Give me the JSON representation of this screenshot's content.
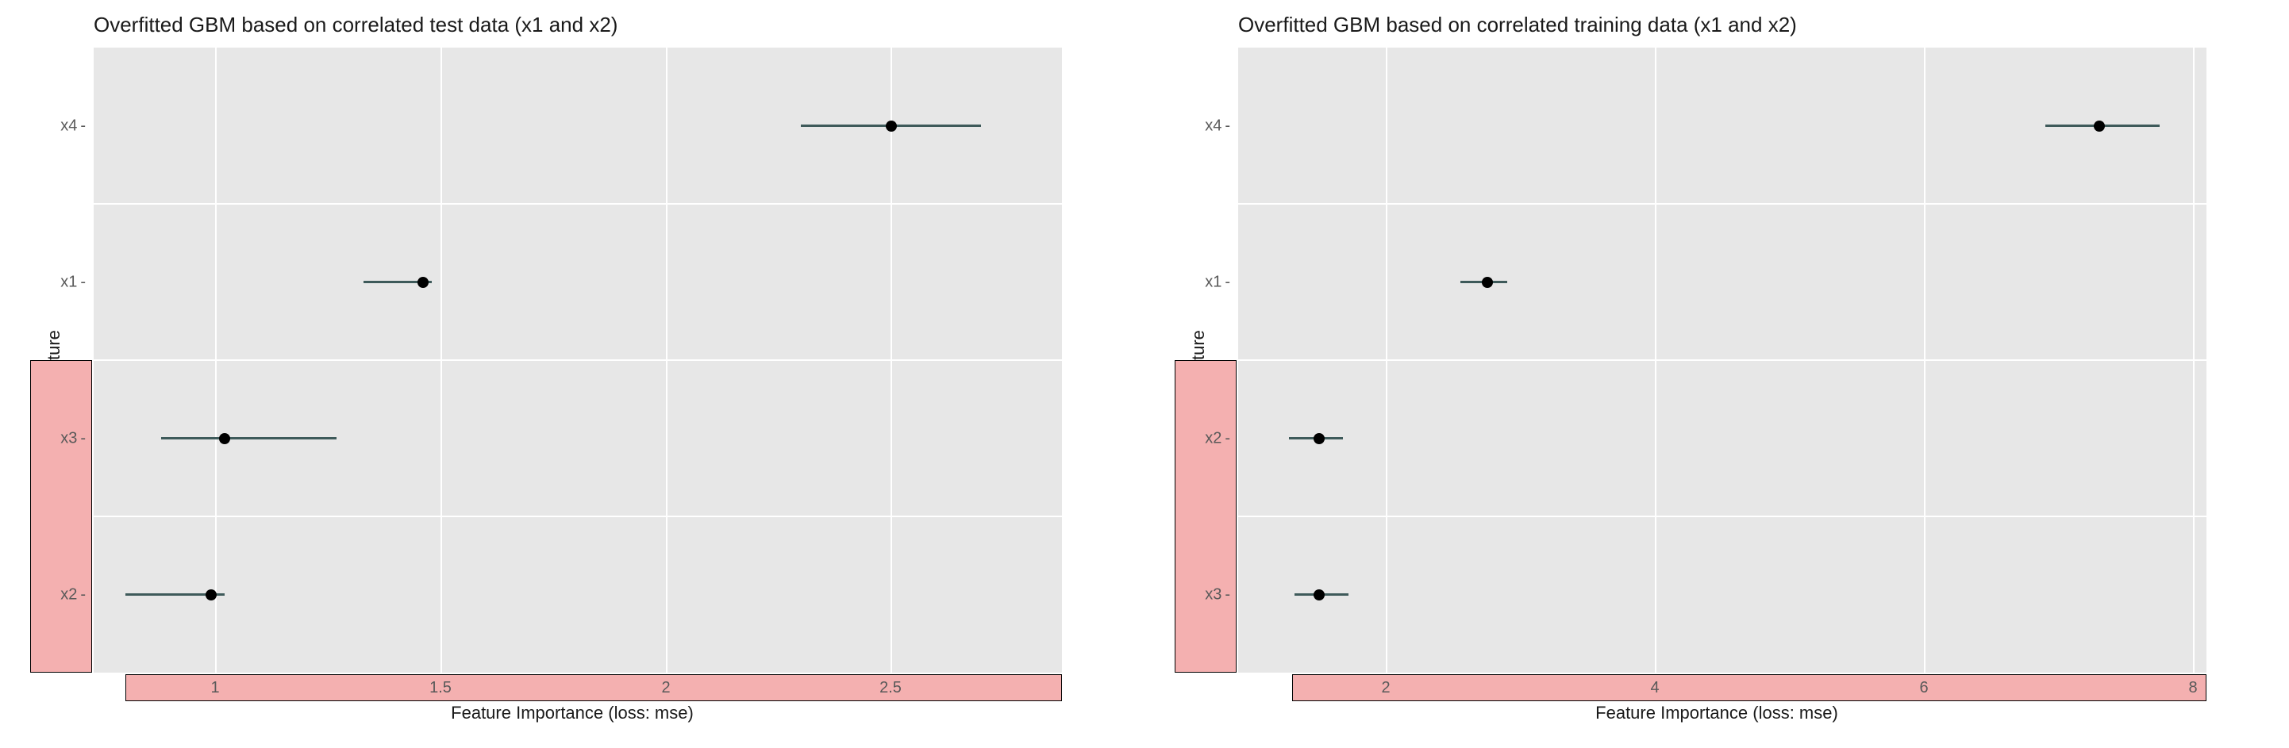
{
  "chart_data": [
    {
      "type": "point-range",
      "title": "Overfitted GBM based on correlated test data (x1 and x2)",
      "xlabel": "Feature Importance (loss: mse)",
      "ylabel": "Feature",
      "xlim": [
        0.73,
        2.88
      ],
      "xticks": [
        1.0,
        1.5,
        2.0,
        2.5
      ],
      "categories_top_to_bottom": [
        "x4",
        "x1",
        "x3",
        "x2"
      ],
      "series": [
        {
          "feature": "x4",
          "value": 2.5,
          "lo": 2.3,
          "hi": 2.7
        },
        {
          "feature": "x1",
          "value": 1.46,
          "lo": 1.33,
          "hi": 1.48
        },
        {
          "feature": "x3",
          "value": 1.02,
          "lo": 0.88,
          "hi": 1.27
        },
        {
          "feature": "x2",
          "value": 0.99,
          "lo": 0.8,
          "hi": 1.02
        }
      ],
      "highlight_y": [
        "x3",
        "x2"
      ],
      "highlight_x_from": 0.8
    },
    {
      "type": "point-range",
      "title": "Overfitted GBM based on correlated training data (x1 and x2)",
      "xlabel": "Feature Importance (loss: mse)",
      "ylabel": "Feature",
      "xlim": [
        0.9,
        8.1
      ],
      "xticks": [
        2,
        4,
        6,
        8
      ],
      "categories_top_to_bottom": [
        "x4",
        "x1",
        "x2",
        "x3"
      ],
      "series": [
        {
          "feature": "x4",
          "value": 7.3,
          "lo": 6.9,
          "hi": 7.75
        },
        {
          "feature": "x1",
          "value": 2.75,
          "lo": 2.55,
          "hi": 2.9
        },
        {
          "feature": "x2",
          "value": 1.5,
          "lo": 1.28,
          "hi": 1.68
        },
        {
          "feature": "x3",
          "value": 1.5,
          "lo": 1.32,
          "hi": 1.72
        }
      ],
      "highlight_y": [
        "x2",
        "x3"
      ],
      "highlight_x_from": 1.3
    }
  ]
}
